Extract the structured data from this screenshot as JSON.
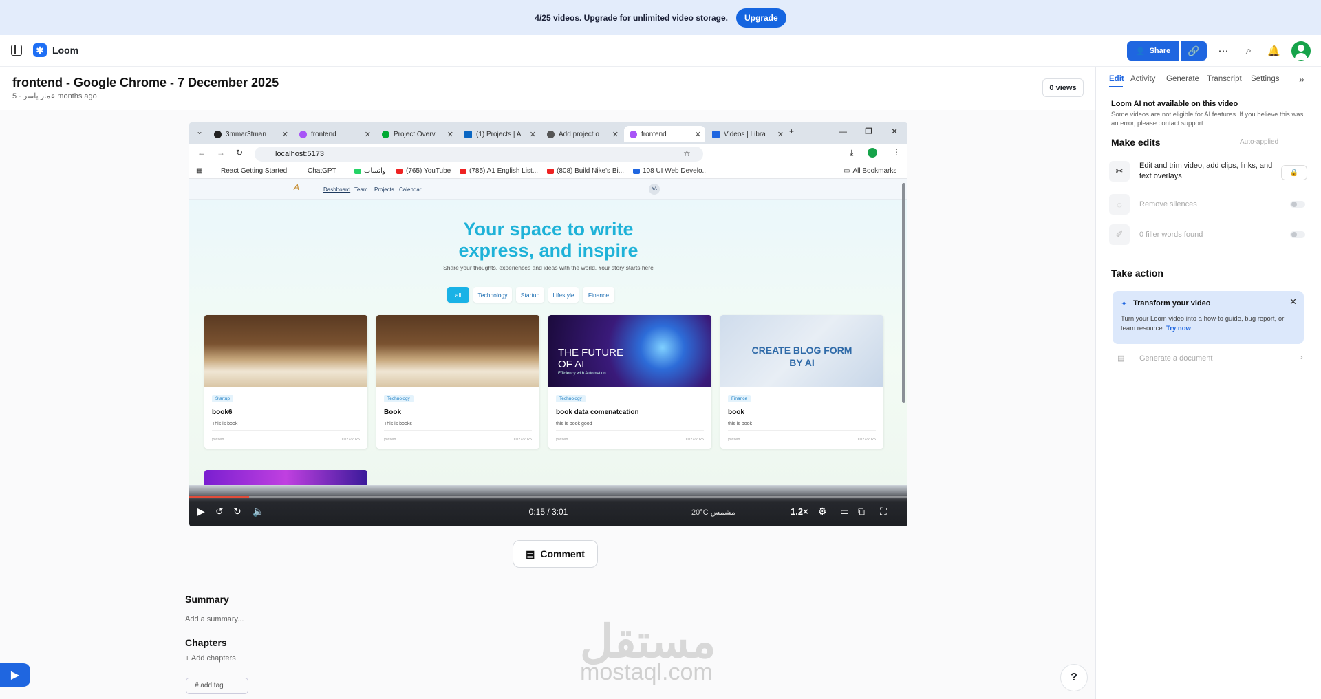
{
  "banner": {
    "text": "4/25 videos. Upgrade for unlimited video storage.",
    "upgrade_label": "Upgrade"
  },
  "header": {
    "brand": "Loom",
    "share_label": "Share"
  },
  "video": {
    "title": "frontend - Google Chrome - 7 December 2025",
    "author": "عمار ياسر",
    "age": "5 months ago",
    "views": "0 views"
  },
  "browser": {
    "tabs": [
      "3mmar3tman",
      "frontend",
      "Project Overv",
      "(1) Projects | A",
      "Add project o",
      "frontend",
      "Videos | Libra"
    ],
    "url": "localhost:5173",
    "bookmarks": [
      "React Getting Started",
      "ChatGPT",
      "واتساب",
      "(765) YouTube",
      "(785) A1 English List...",
      "(808) Build Nike's Bi...",
      "108 UI Web Develo..."
    ],
    "all_bookmarks": "All Bookmarks"
  },
  "site": {
    "nav": [
      "Dashboard",
      "Team",
      "Projects",
      "Calendar"
    ],
    "avatar_initials": "YA",
    "hero_line1": "Your space to write",
    "hero_line2": "express, and inspire",
    "hero_sub": "Share your thoughts, experiences and ideas with the world. Your story starts here",
    "filters": [
      "all",
      "Technology",
      "Startup",
      "Lifestyle",
      "Finance"
    ],
    "cards": [
      {
        "tag": "Startup",
        "title": "book6",
        "desc": "This is book",
        "author": "yassen",
        "date": "11/27/2025"
      },
      {
        "tag": "Technology",
        "title": "Book",
        "desc": "This is books",
        "author": "yassen",
        "date": "11/27/2025"
      },
      {
        "tag": "Technology",
        "title": "book data comenatcation",
        "desc": "this is book good",
        "author": "yassen",
        "date": "11/27/2025",
        "img_line1": "THE FUTURE",
        "img_line2": "OF AI",
        "img_small": "Efficiency with Automation"
      },
      {
        "tag": "Finance",
        "title": "book",
        "desc": "this is book",
        "author": "yassen",
        "date": "11/27/2025",
        "img_line1": "CREATE BLOG FORM",
        "img_line2": "BY AI"
      }
    ]
  },
  "player": {
    "time": "0:15 / 3:01",
    "speed": "1.2×",
    "weather": "20°C  مشمس",
    "progress": 0.083
  },
  "below": {
    "comment_label": "Comment",
    "summary_title": "Summary",
    "summary_add": "Add a summary...",
    "chapters_title": "Chapters",
    "chapters_add": "+ Add chapters",
    "tag_label": "# add tag",
    "help": "?",
    "watermark_ar": "مستقل",
    "watermark_en": "mostaql.com"
  },
  "right_panel": {
    "tabs": [
      "Edit",
      "Activity",
      "Generate",
      "Transcript",
      "Settings"
    ],
    "ai_title": "Loom AI not available on this video",
    "ai_note": "Some videos are not eligible for AI features. If you believe this was an error, please contact support.",
    "make_edits": "Make edits",
    "auto_applied": "Auto-applied",
    "edit_row": "Edit and trim video, add clips, links, and text overlays",
    "remove_silences": "Remove silences",
    "filler_words": "0 filler words found",
    "take_action": "Take action",
    "transform_title": "Transform your video",
    "transform_text": "Turn your Loom video into a how-to guide, bug report, or team resource.",
    "try_now": "Try now",
    "generate_doc": "Generate a document"
  },
  "colors": {
    "accent": "#1f66e0",
    "banner_bg": "#e3ecfb",
    "hero": "#1fb2d8",
    "progress": "#e24c3a"
  }
}
